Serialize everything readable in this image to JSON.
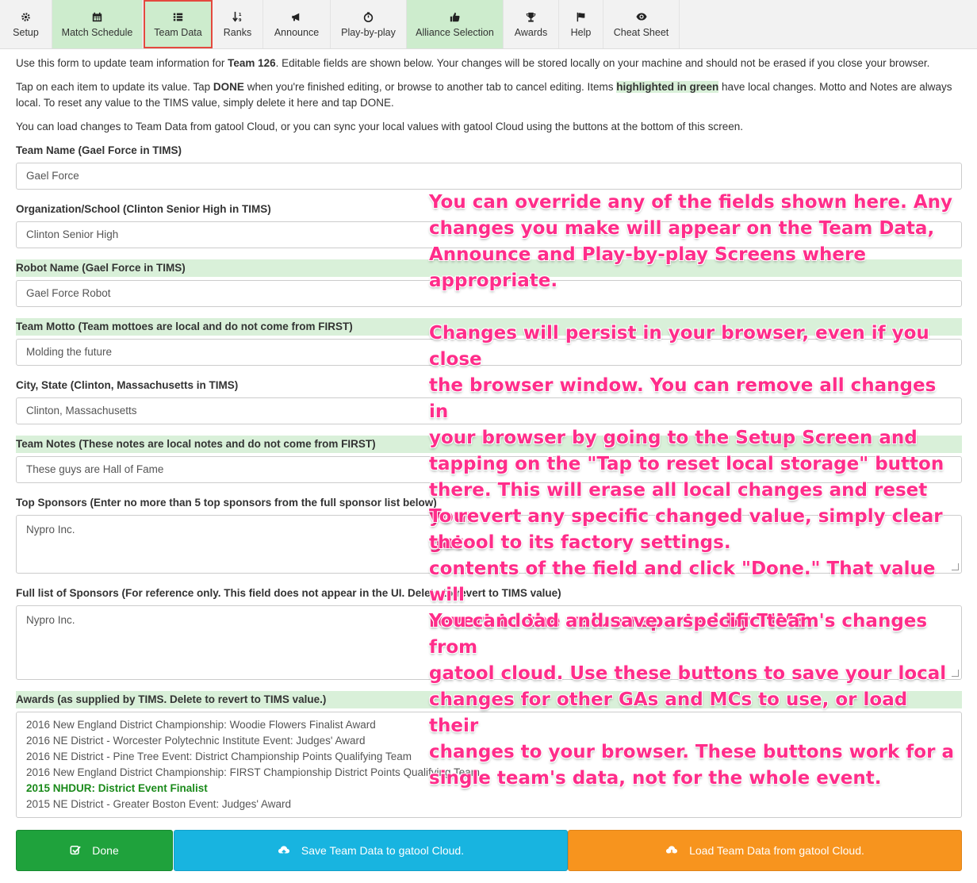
{
  "nav": {
    "tabs": [
      {
        "label": "Setup",
        "icon": "gear-icon"
      },
      {
        "label": "Match Schedule",
        "icon": "calendar-icon"
      },
      {
        "label": "Team Data",
        "icon": "list-icon"
      },
      {
        "label": "Ranks",
        "icon": "sort-icon"
      },
      {
        "label": "Announce",
        "icon": "bullhorn-icon"
      },
      {
        "label": "Play-by-play",
        "icon": "stopwatch-icon"
      },
      {
        "label": "Alliance Selection",
        "icon": "thumbs-up-icon"
      },
      {
        "label": "Awards",
        "icon": "trophy-icon"
      },
      {
        "label": "Help",
        "icon": "flag-icon"
      },
      {
        "label": "Cheat Sheet",
        "icon": "eye-icon"
      }
    ],
    "active_tab": "Team Data"
  },
  "intro": {
    "p1_a": "Use this form to update team information for ",
    "p1_team": "Team 126",
    "p1_b": ". Editable fields are shown below. Your changes will be stored locally on your machine and should not be erased if you close your browser.",
    "p2_a": "Tap on each item to update its value. Tap ",
    "p2_done": "DONE",
    "p2_b": " when you're finished editing, or browse to another tab to cancel editing. Items ",
    "p2_hl": "highlighted in green",
    "p2_c": " have local changes. Motto and Notes are always local. To reset any value to the TIMS value, simply delete it here and tap DONE.",
    "p3": "You can load changes to Team Data from gatool Cloud, or you can sync your local values with gatool Cloud using the buttons at the bottom of this screen."
  },
  "fields": {
    "team_name": {
      "label": "Team Name (Gael Force in TIMS)",
      "value": "Gael Force"
    },
    "org": {
      "label": "Organization/School (Clinton Senior High in TIMS)",
      "value": "Clinton Senior High"
    },
    "robot": {
      "label": "Robot Name (Gael Force in TIMS)",
      "value": "Gael Force Robot"
    },
    "motto": {
      "label": "Team Motto (Team mottoes are local and do not come from FIRST)",
      "value": "Molding the future"
    },
    "city": {
      "label": "City, State (Clinton, Massachusetts in TIMS)",
      "value": "Clinton, Massachusetts"
    },
    "notes": {
      "label": "Team Notes (These notes are local notes and do not come from FIRST)",
      "value": "These guys are Hall of Fame"
    },
    "top_sponsors": {
      "label": "Top Sponsors (Enter no more than 5 top sponsors from the full sponsor list below)",
      "value": "Nypro Inc."
    },
    "full_sponsors": {
      "label": "Full list of Sponsors (For reference only. This field does not appear in the UI. Delete to revert to TIMS value)",
      "value": "Nypro Inc."
    },
    "awards": {
      "label": "Awards (as supplied by TIMS. Delete to revert to TIMS value.)",
      "lines": [
        "2016 New England District Championship: Woodie Flowers Finalist Award",
        "2016 NE District - Worcester Polytechnic Institute Event: Judges' Award",
        "2016 NE District - Pine Tree Event: District Championship Points Qualifying Team",
        "2016 New England District Championship: FIRST Championship District Points Qualifying Team",
        "2015 NHDUR: District Event Finalist",
        "2015 NE District - Greater Boston Event: Judges' Award"
      ]
    }
  },
  "buttons": {
    "done": "Done",
    "save": "Save Team Data to gatool Cloud.",
    "load": "Load Team Data from gatool Cloud."
  },
  "annotations": {
    "note1": "You can override any of the fields shown here. Any\nchanges you make will appear on the Team Data,\nAnnounce and Play-by-play Screens where\nappropriate.",
    "note2": "Changes will persist in your browser, even if you close\nthe browser window. You can remove all changes in\nyour browser by going to the Setup Screen and\ntapping on the \"Tap to reset local storage\" button\nthere. This will erase all local changes and reset your\ngatool to its factory settings.",
    "note3": "To revert any specific changed value, simply clear the\ncontents of the field and click \"Done.\" That value will\nrevert to the value reported by TIMS.",
    "note4": "You can load and save a specific team's changes from\ngatool cloud. Use these buttons to save your local\nchanges for other GAs and MCs to use, or load their\nchanges to your browser. These buttons work for a\nsingle team's data, not for the whole event."
  },
  "colors": {
    "accent_green": "#d9f0d9",
    "active_border": "#e4493f",
    "annotation": "#ff2d8a",
    "done": "#1fa23c",
    "save": "#18b4e0",
    "load": "#f7941e"
  }
}
